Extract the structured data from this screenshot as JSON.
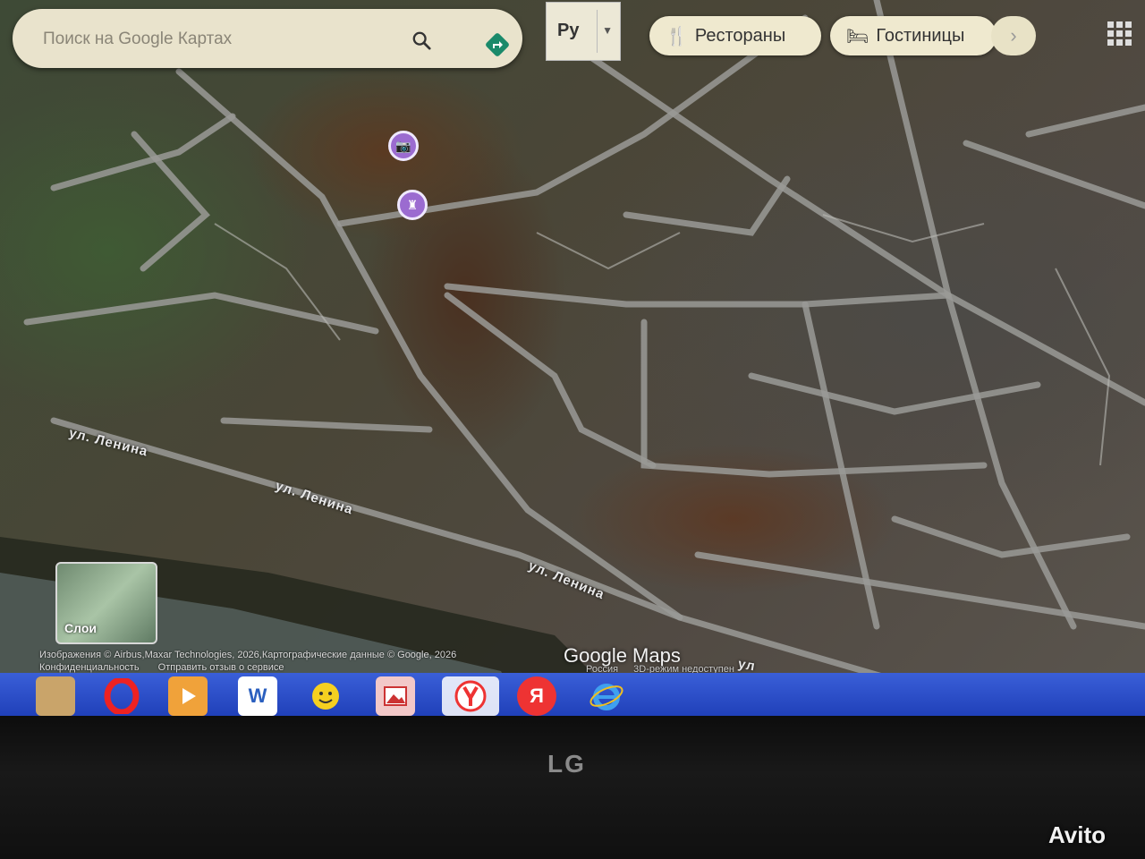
{
  "search": {
    "placeholder": "Поиск на Google Картах"
  },
  "language": {
    "label": "Ру"
  },
  "chips": {
    "restaurants": "Рестораны",
    "hotels": "Гостиницы",
    "next": "›"
  },
  "streets": [
    "ул. Ленина",
    "ул. Ленина",
    "ул. Ленина",
    "ул"
  ],
  "layers": {
    "label": "Слои"
  },
  "attribution": {
    "imagery": "Изображения © Airbus,Maxar Technologies, 2026,Картографические данные © Google, 2026",
    "privacy": "Конфиденциальность",
    "feedback": "Отправить отзыв о сервисе"
  },
  "google": {
    "logo": "Google Maps",
    "country": "Россия",
    "mode": "3D-режим недоступен"
  },
  "taskbar": {
    "items": [
      "opera",
      "media",
      "word",
      "messenger",
      "photos",
      "yandex-browser",
      "yandex",
      "internet-explorer"
    ],
    "word_letter": "W",
    "yandex_letter": "Я"
  },
  "monitor": {
    "brand": "LG"
  },
  "watermark": {
    "text": "Avito"
  },
  "colors": {
    "marker": "#9b6bd0",
    "taskbar": "#2a4fd0",
    "searchbox": "#e9e3cc"
  }
}
